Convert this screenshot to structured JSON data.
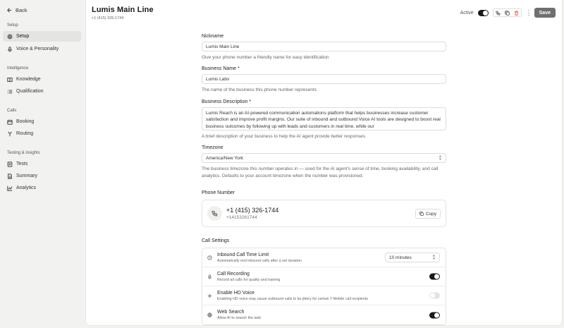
{
  "sidebar": {
    "back_label": "Back",
    "sections": [
      {
        "label": "Setup",
        "items": [
          {
            "label": "Setup",
            "icon": "settings-icon",
            "active": true
          },
          {
            "label": "Voice & Personality",
            "icon": "mic-icon"
          }
        ]
      },
      {
        "label": "Intelligence",
        "items": [
          {
            "label": "Knowledge",
            "icon": "book-icon"
          },
          {
            "label": "Qualification",
            "icon": "list-icon"
          }
        ]
      },
      {
        "label": "Calls",
        "items": [
          {
            "label": "Booking",
            "icon": "calendar-icon"
          },
          {
            "label": "Routing",
            "icon": "routing-icon"
          }
        ]
      },
      {
        "label": "Testing & insights",
        "items": [
          {
            "label": "Tests",
            "icon": "test-icon"
          },
          {
            "label": "Summary",
            "icon": "summary-icon"
          },
          {
            "label": "Analytics",
            "icon": "analytics-icon"
          }
        ]
      }
    ]
  },
  "header": {
    "title": "Lumis Main Line",
    "subtitle": "+1 (415) 326-1744",
    "active_label": "Active",
    "active_on": true,
    "save_label": "Save"
  },
  "form": {
    "nickname": {
      "label": "Nickname",
      "value": "Lumis Main Line",
      "help": "Give your phone number a friendly name for easy identification"
    },
    "business_name": {
      "label": "Business Name *",
      "value": "Lumis Labs",
      "help": "The name of the business this phone number represents"
    },
    "business_description": {
      "label": "Business Description *",
      "value": "Lumis Reach is an AI-powered communication automations platform that helps businesses increase customer satisfaction and improve profit margins. Our suite of inbound and outbound Voice AI tools are designed to boost real business outcomes by following up with leads and customers in real time, while our",
      "help": "A brief description of your business to help the AI agent provide better responses"
    },
    "timezone": {
      "label": "Timezone",
      "value": "America/New York",
      "help": "The business timezone this number operates in — used for the AI agent's sense of time, booking availability, and call analytics. Defaults to your account timezone when the number was provisioned."
    }
  },
  "phone_number": {
    "section_label": "Phone Number",
    "formatted": "+1 (415) 326-1744",
    "raw": "+14153261744",
    "copy_label": "Copy"
  },
  "call_settings": {
    "section_label": "Call Settings",
    "rows": [
      {
        "name": "Inbound Call Time Limit",
        "desc": "Automatically end inbound calls after a set duration",
        "icon": "clock-icon",
        "control": "select",
        "value": "10 minutes"
      },
      {
        "name": "Call Recording",
        "desc": "Record all calls for quality and training",
        "icon": "mic-icon",
        "control": "toggle",
        "on": true
      },
      {
        "name": "Enable HD Voice",
        "desc": "Enabling HD voice may cause outbound calls to be jittery for certain T-Mobile call recipients",
        "icon": "waveform-icon",
        "control": "toggle",
        "on": false
      },
      {
        "name": "Web Search",
        "desc": "Allow AI to search the web",
        "icon": "globe-icon",
        "control": "toggle",
        "on": true
      }
    ]
  },
  "colors": {
    "accent": "#1a1a1a",
    "save_button": "#6f6f6f",
    "delete_icon": "#e04a4a"
  }
}
